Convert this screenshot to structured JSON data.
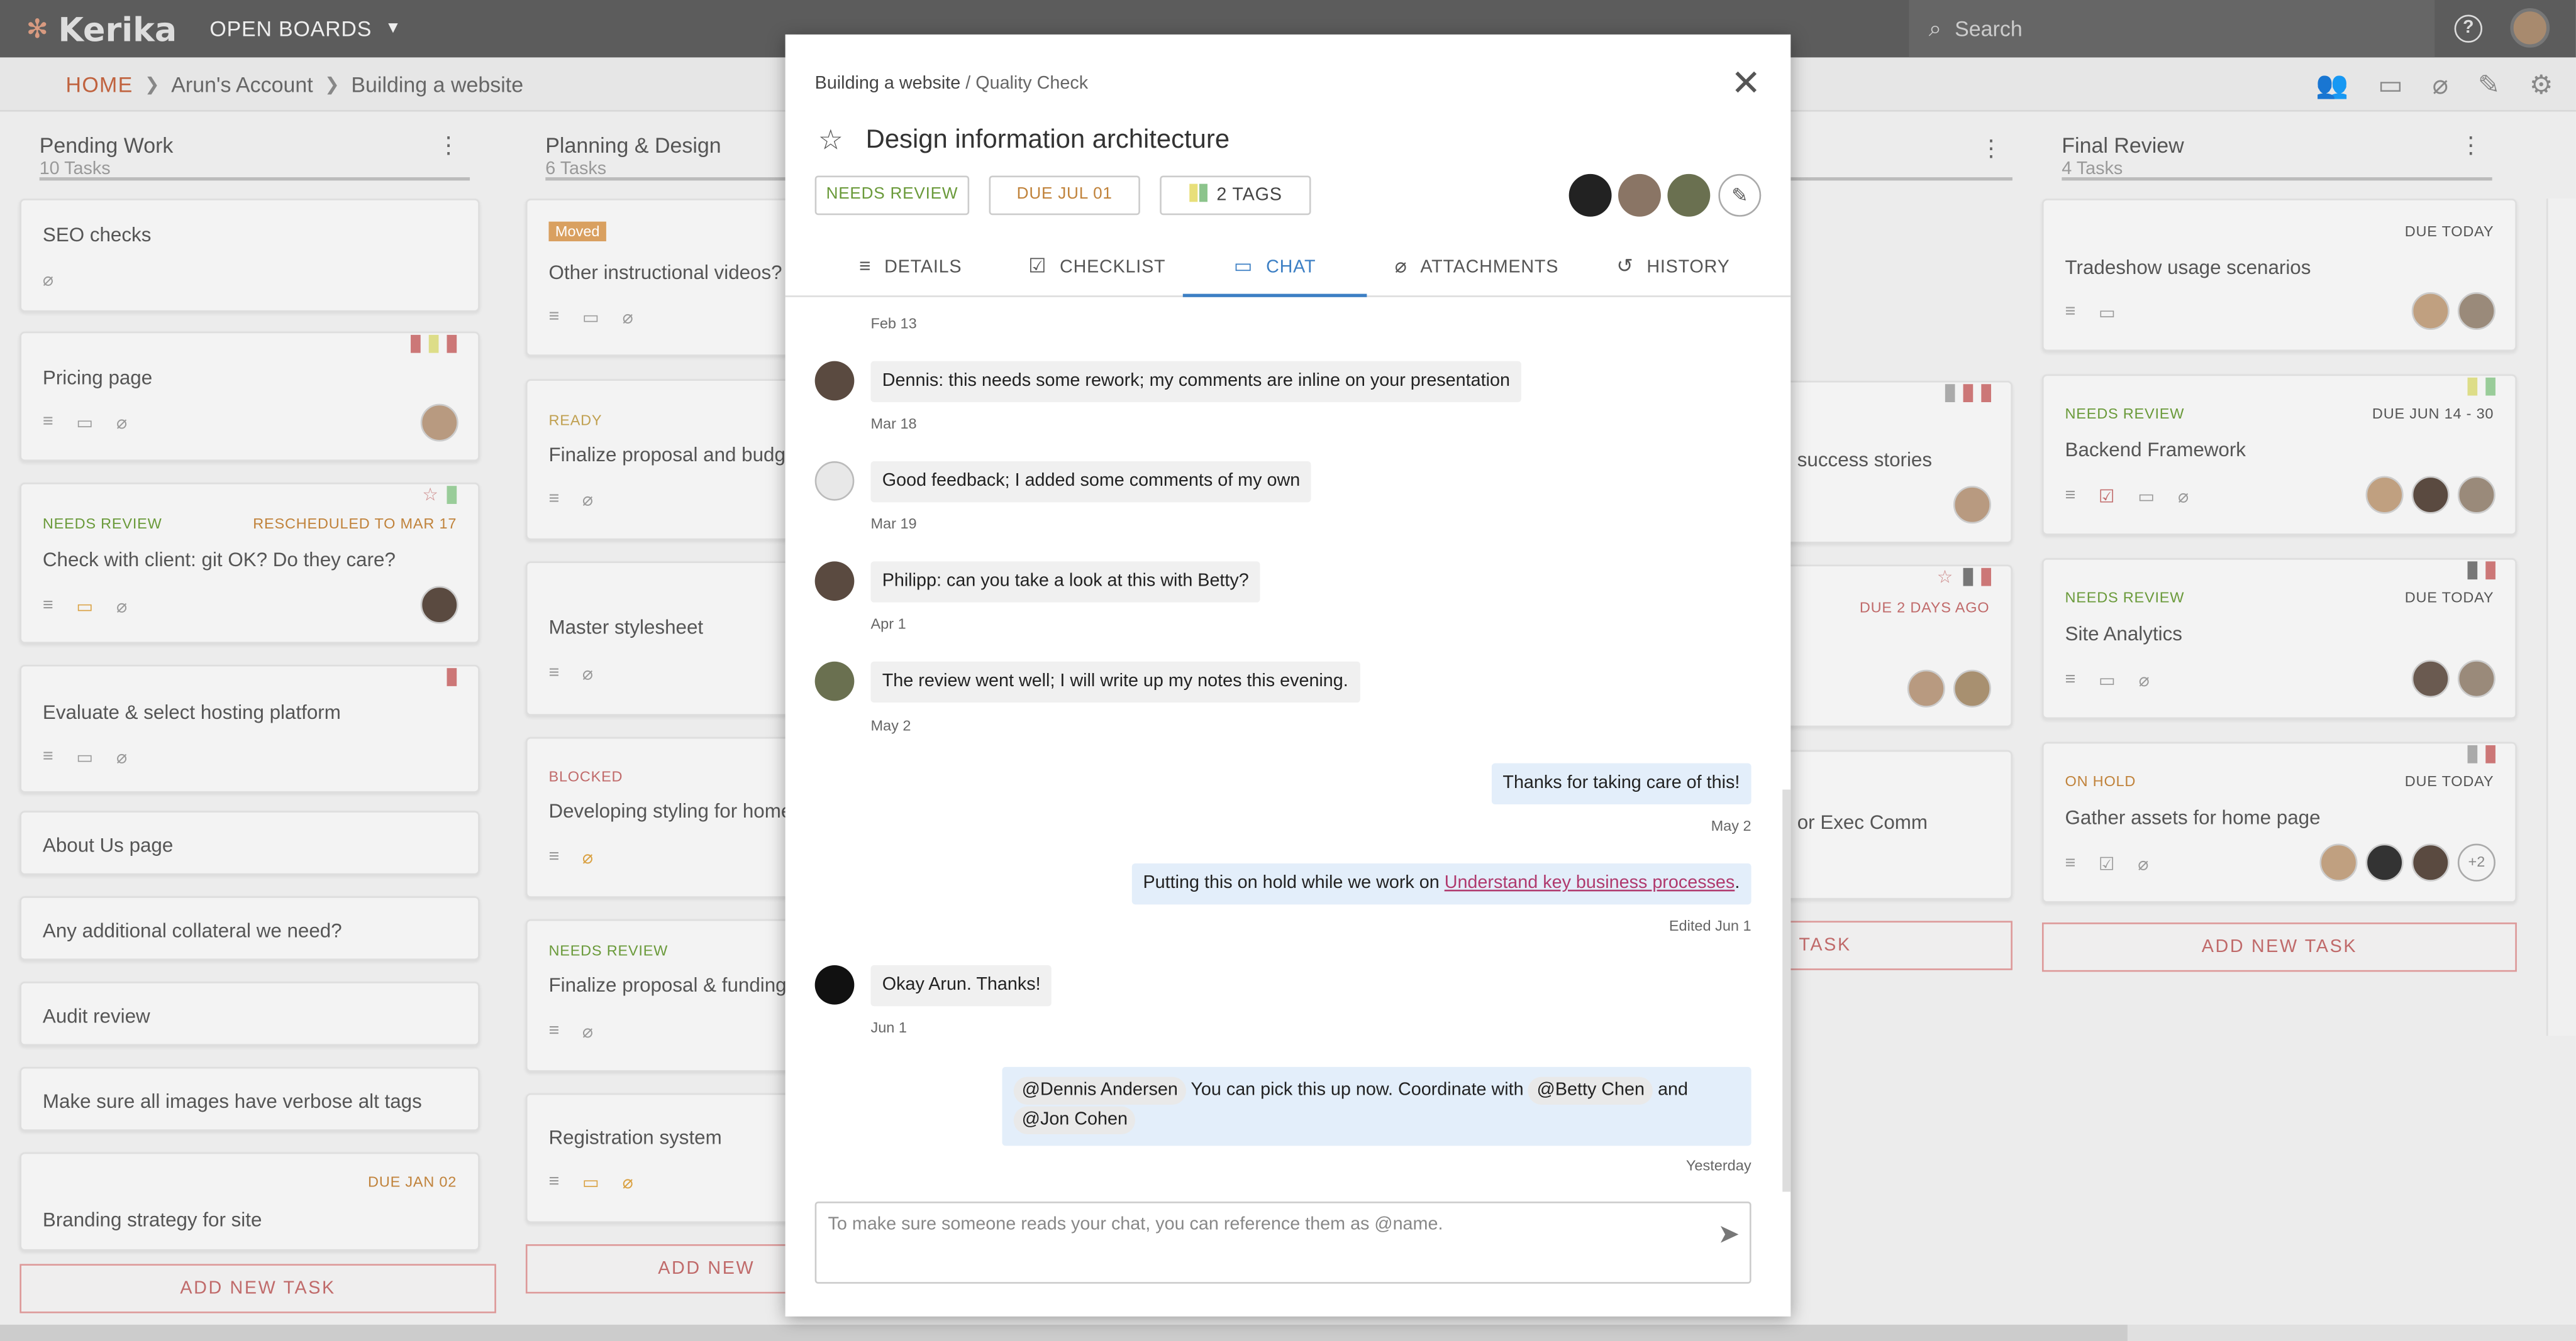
{
  "app": {
    "logo": "Kerika",
    "open_boards": "OPEN BOARDS",
    "search_placeholder": "Search"
  },
  "breadcrumb": {
    "home": "HOME",
    "account": "Arun's Account",
    "board": "Building a website"
  },
  "columns": [
    {
      "title": "Pending Work",
      "count": "10 Tasks",
      "add": "ADD NEW TASK",
      "cards": [
        {
          "title": "SEO checks"
        },
        {
          "title": "Pricing page"
        },
        {
          "title": "Check with client: git OK? Do they care?",
          "status": "NEEDS REVIEW",
          "due": "RESCHEDULED TO MAR 17"
        },
        {
          "title": "Evaluate & select hosting platform"
        },
        {
          "title": "About Us page"
        },
        {
          "title": "Any additional collateral we need?"
        },
        {
          "title": "Audit review"
        },
        {
          "title": "Make sure all images have verbose alt tags"
        },
        {
          "title": "Branding strategy for site",
          "due": "DUE JAN 02"
        }
      ]
    },
    {
      "title": "Planning & Design",
      "count": "6 Tasks",
      "add": "ADD NEW",
      "cards": [
        {
          "title": "Other instructional videos?",
          "status": "Moved"
        },
        {
          "title": "Finalize proposal and budge",
          "status": "READY"
        },
        {
          "title": "Master stylesheet"
        },
        {
          "title": "Developing styling for home",
          "status": "BLOCKED"
        },
        {
          "title": "Finalize proposal & funding",
          "status": "NEEDS REVIEW"
        },
        {
          "title": "Registration system"
        }
      ]
    },
    {
      "cards": [
        {
          "title": "success stories"
        },
        {
          "title": "",
          "due": "DUE 2 DAYS AGO"
        },
        {
          "title": "or Exec Comm"
        }
      ],
      "add": "TASK"
    },
    {
      "title": "Final Review",
      "count": "4 Tasks",
      "add": "ADD NEW TASK",
      "cards": [
        {
          "title": "Tradeshow usage scenarios",
          "due": "DUE TODAY"
        },
        {
          "title": "Backend Framework",
          "status": "NEEDS REVIEW",
          "due": "DUE JUN 14 - 30"
        },
        {
          "title": "Site Analytics",
          "status": "NEEDS REVIEW",
          "due": "DUE TODAY"
        },
        {
          "title": "Gather assets for home page",
          "status": "ON HOLD",
          "due": "DUE TODAY",
          "more": "+2"
        }
      ]
    }
  ],
  "modal": {
    "crumb_board": "Building a website",
    "crumb_sep": " / ",
    "crumb_col": "Quality Check",
    "title": "Design information architecture",
    "status": "NEEDS REVIEW",
    "due": "DUE JUL 01",
    "tags": "2 TAGS",
    "tabs": [
      "DETAILS",
      "CHECKLIST",
      "CHAT",
      "ATTACHMENTS",
      "HISTORY"
    ],
    "active_tab": "CHAT",
    "messages": [
      {
        "date": "Feb 13"
      },
      {
        "text": "Dennis: this needs some rework; my comments are inline on your presentation",
        "date": "Mar 18"
      },
      {
        "text": "Good feedback; I added some comments of my own",
        "date": "Mar 19"
      },
      {
        "text": "Philipp: can you take a look at this with Betty?",
        "date": "Apr 1"
      },
      {
        "text": "The review went well; I will write up my notes this evening.",
        "date": "May 2"
      },
      {
        "text": "Thanks for taking care of this!",
        "date": "May 2"
      },
      {
        "text_pre": "Putting this on hold while we work on ",
        "link": "Understand key business processes",
        "text_post": ".",
        "date": "Edited Jun 1"
      },
      {
        "text": "Okay Arun. Thanks!",
        "date": "Jun 1"
      },
      {
        "mention1": "@Dennis Andersen",
        "text_a": "You can pick this up now. Coordinate with",
        "mention2": "@Betty Chen",
        "text_b": "and",
        "mention3": "@Jon Cohen",
        "date": "Yesterday"
      }
    ],
    "composer_placeholder": "To make sure someone reads your chat, you can reference them as @name."
  },
  "colors": {
    "accent": "#3c7fc4",
    "needs_review": "#6a9a3a",
    "due": "#c0823a",
    "danger": "#c06a6a",
    "link": "#b03a6e"
  }
}
